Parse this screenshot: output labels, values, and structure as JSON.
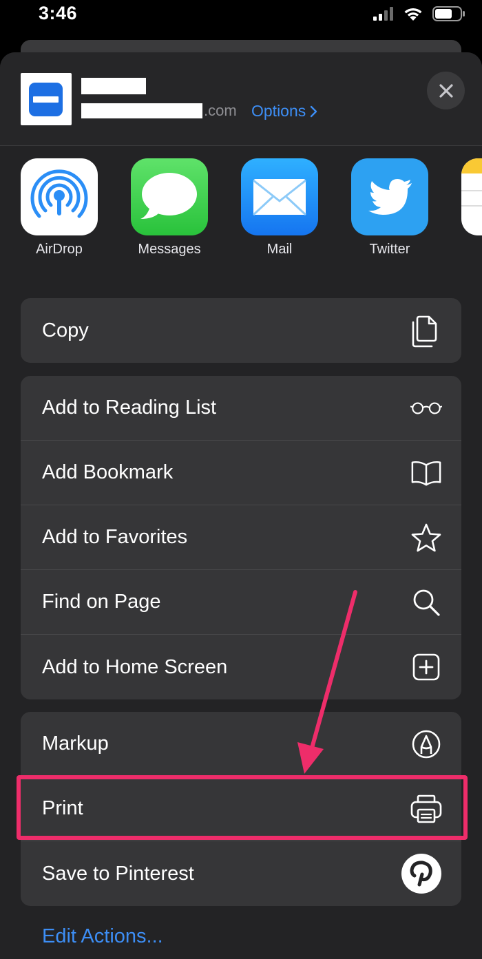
{
  "status_bar": {
    "time": "3:46"
  },
  "header": {
    "url_suffix": ".com",
    "options_label": "Options",
    "close_icon": "close-icon"
  },
  "share_targets": [
    {
      "label": "AirDrop",
      "icon": "airdrop-icon"
    },
    {
      "label": "Messages",
      "icon": "messages-icon"
    },
    {
      "label": "Mail",
      "icon": "mail-icon"
    },
    {
      "label": "Twitter",
      "icon": "twitter-icon"
    },
    {
      "label": "",
      "icon": "notes-icon"
    }
  ],
  "actions": {
    "group1": [
      {
        "label": "Copy",
        "icon": "copy-icon"
      }
    ],
    "group2": [
      {
        "label": "Add to Reading List",
        "icon": "glasses-icon"
      },
      {
        "label": "Add Bookmark",
        "icon": "book-icon"
      },
      {
        "label": "Add to Favorites",
        "icon": "star-icon"
      },
      {
        "label": "Find on Page",
        "icon": "search-icon"
      },
      {
        "label": "Add to Home Screen",
        "icon": "plus-square-icon"
      }
    ],
    "group3": [
      {
        "label": "Markup",
        "icon": "markup-icon"
      },
      {
        "label": "Print",
        "icon": "printer-icon"
      },
      {
        "label": "Save to Pinterest",
        "icon": "pinterest-icon"
      }
    ]
  },
  "edit_actions_label": "Edit Actions...",
  "colors": {
    "accent": "#3d8ef5",
    "highlight": "#ee2d6a",
    "sheet_bg": "#232325",
    "row_bg": "#363638"
  }
}
